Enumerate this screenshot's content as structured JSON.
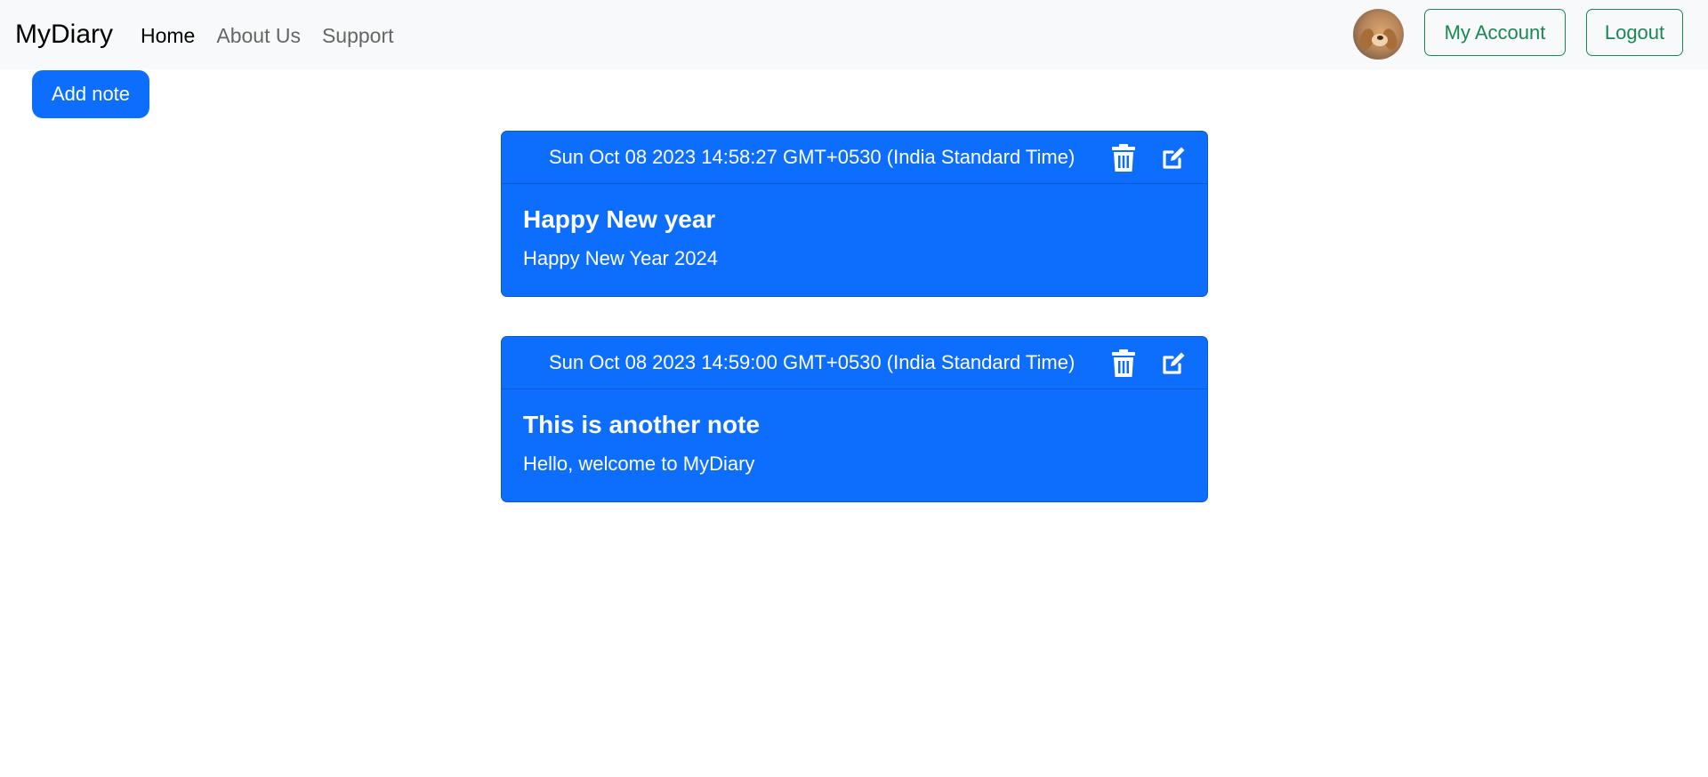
{
  "navbar": {
    "brand": "MyDiary",
    "links": [
      {
        "label": "Home",
        "active": true
      },
      {
        "label": "About Us",
        "active": false
      },
      {
        "label": "Support",
        "active": false
      }
    ],
    "avatar_icon": "user-avatar-puppy",
    "account_label": "My Account",
    "logout_label": "Logout"
  },
  "actions": {
    "add_note_label": "Add note"
  },
  "notes": [
    {
      "date": "Sun Oct 08 2023 14:58:27 GMT+0530 (India Standard Time)",
      "title": "Happy New year",
      "body": "Happy New Year 2024"
    },
    {
      "date": "Sun Oct 08 2023 14:59:00 GMT+0530 (India Standard Time)",
      "title": "This is another note",
      "body": "Hello, welcome to MyDiary"
    }
  ],
  "icons": {
    "delete": "trash-icon",
    "edit": "edit-icon"
  },
  "colors": {
    "primary": "#0d6efd",
    "success": "#198754",
    "navbar_bg": "#f8f9fa"
  }
}
